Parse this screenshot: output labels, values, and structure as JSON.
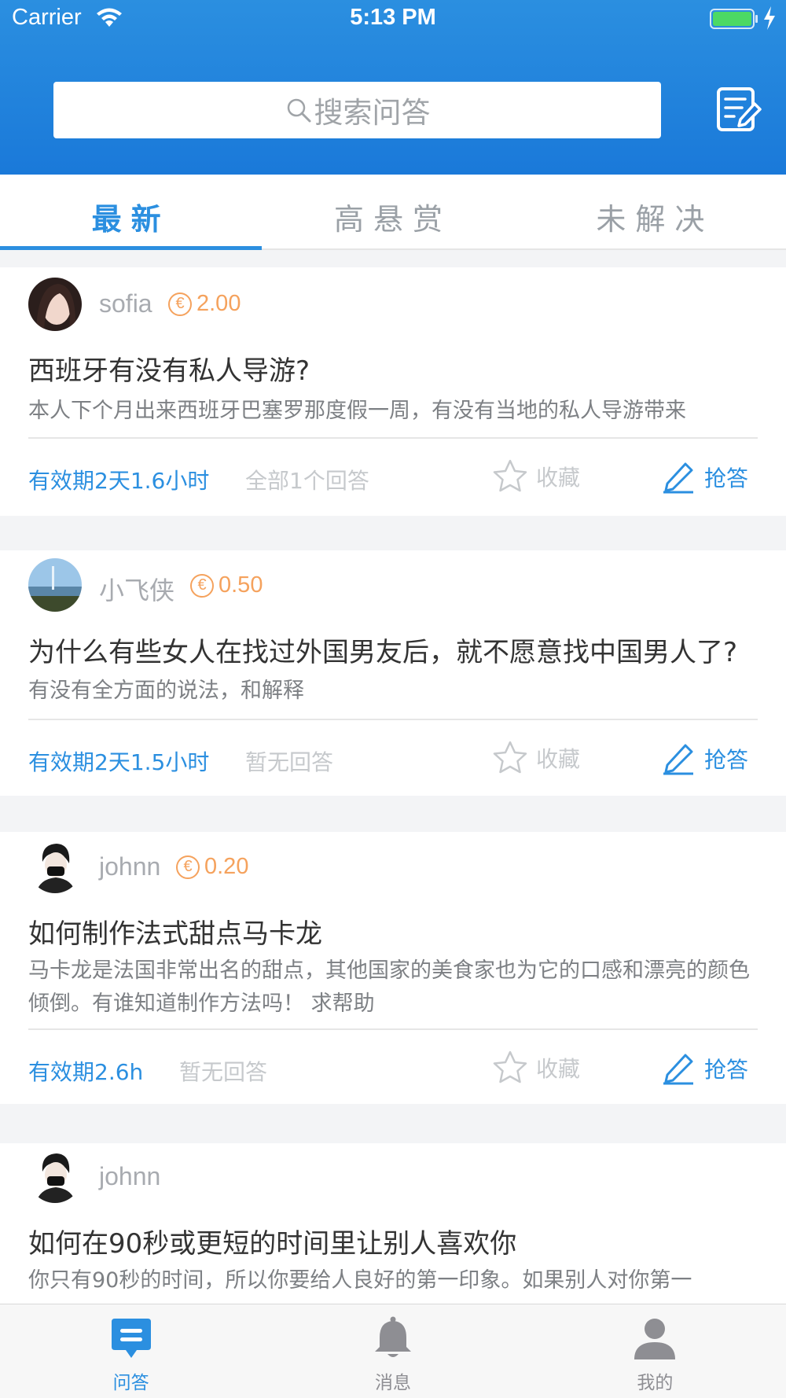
{
  "status_bar": {
    "carrier": "Carrier",
    "time": "5:13 PM"
  },
  "search": {
    "placeholder": "搜索问答"
  },
  "tabs": [
    {
      "label": "最新",
      "active": true
    },
    {
      "label": "高悬赏",
      "active": false
    },
    {
      "label": "未解决",
      "active": false
    }
  ],
  "questions": [
    {
      "user": "sofia",
      "reward": "2.00",
      "title": "西班牙有没有私人导游?",
      "desc": "本人下个月出来西班牙巴塞罗那度假一周，有没有当地的私人导游带来",
      "validity": "有效期2天1.6小时",
      "answers": "全部1个回答",
      "fav": "收藏",
      "grab": "抢答"
    },
    {
      "user": "小飞侠",
      "reward": "0.50",
      "title": "为什么有些女人在找过外国男友后，就不愿意找中国男人了?",
      "desc": "有没有全方面的说法，和解释",
      "validity": "有效期2天1.5小时",
      "answers": "暂无回答",
      "fav": "收藏",
      "grab": "抢答"
    },
    {
      "user": "johnn",
      "reward": "0.20",
      "title": "如何制作法式甜点马卡龙",
      "desc": "马卡龙是法国非常出名的甜点，其他国家的美食家也为它的口感和漂亮的颜色倾倒。有谁知道制作方法吗！ 求帮助",
      "validity": "有效期2.6h",
      "answers": "暂无回答",
      "fav": "收藏",
      "grab": "抢答"
    },
    {
      "user": "johnn",
      "title": "如何在90秒或更短的时间里让别人喜欢你",
      "desc": "你只有90秒的时间，所以你要给人良好的第一印象。如果别人对你第一"
    }
  ],
  "tabbar": [
    {
      "label": "问答",
      "icon": "chat-icon",
      "active": true
    },
    {
      "label": "消息",
      "icon": "bell-icon",
      "active": false
    },
    {
      "label": "我的",
      "icon": "person-icon",
      "active": false
    }
  ],
  "colors": {
    "primary": "#2b8fe0",
    "reward": "#f5a25d"
  }
}
